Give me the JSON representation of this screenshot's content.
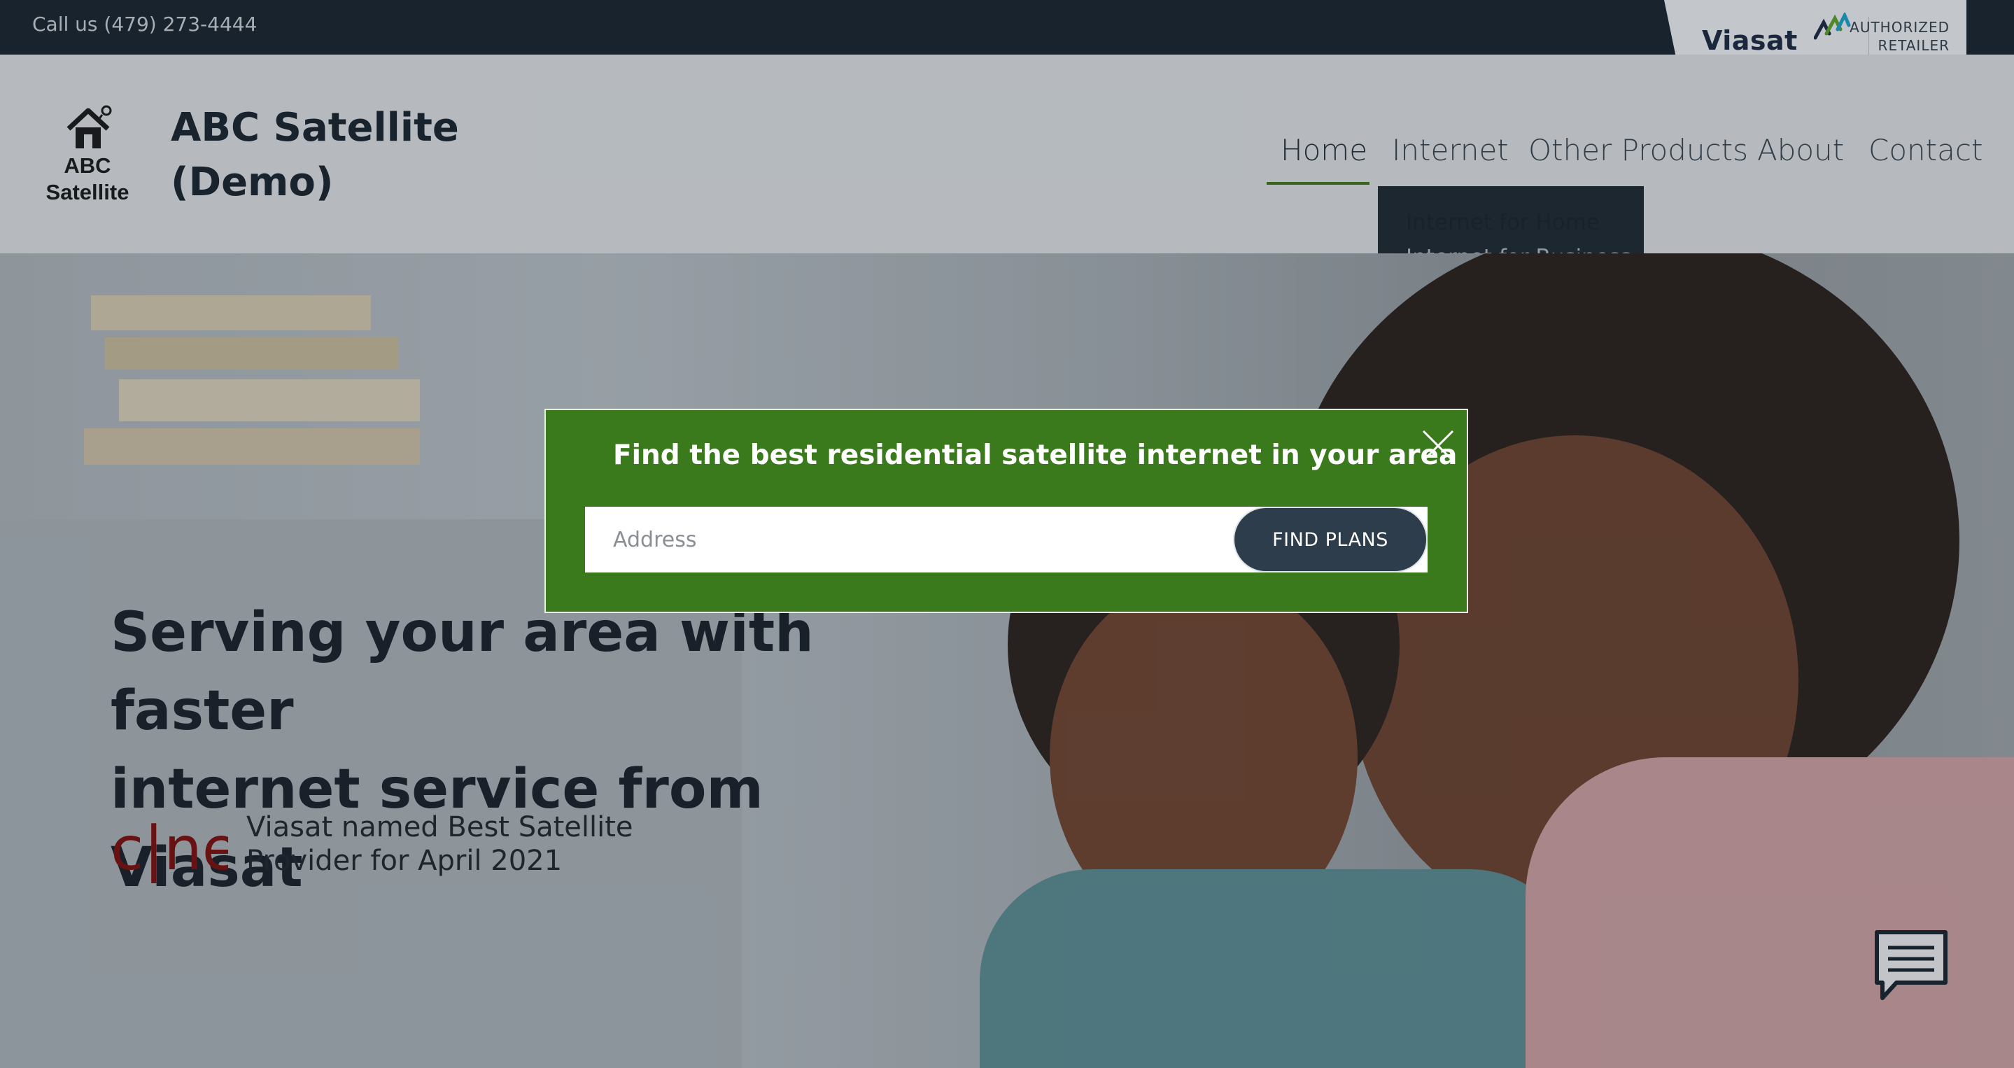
{
  "topbar": {
    "phone": "Call us (479) 273-4444",
    "partner_brand": "Viasat",
    "retailer_line1": "AUTHORIZED",
    "retailer_line2": "RETAILER"
  },
  "header": {
    "logo_line1": "ABC",
    "logo_line2": "Satellite",
    "site_name_line1": "ABC Satellite",
    "site_name_line2": "(Demo)",
    "nav": [
      {
        "label": "Home",
        "active": true
      },
      {
        "label": "Internet",
        "active": false
      },
      {
        "label": "Other Products",
        "active": false
      },
      {
        "label": "About",
        "active": false
      },
      {
        "label": "Contact",
        "active": false
      }
    ],
    "dropdown": [
      {
        "label": "Internet for Home"
      },
      {
        "label": "Internet for Business"
      }
    ]
  },
  "hero": {
    "title_line1": "Serving your area with faster",
    "title_line2": "internet service from Viasat",
    "award_brand": "c|net",
    "award_line1": "Viasat named Best Satellite",
    "award_line2": "Provider for April 2021"
  },
  "modal": {
    "title": "Find the best residential satellite internet in your area",
    "address_placeholder": "Address",
    "address_value": "",
    "button_label": "FIND PLANS"
  },
  "icons": {
    "close": "close-icon",
    "chat": "chat-icon",
    "house": "house-satellite-icon"
  },
  "colors": {
    "topbar": "#1a2530",
    "accent_green": "#3a7a1c",
    "button_dark": "#2e3d4c",
    "cnet_red": "#7a1010"
  }
}
